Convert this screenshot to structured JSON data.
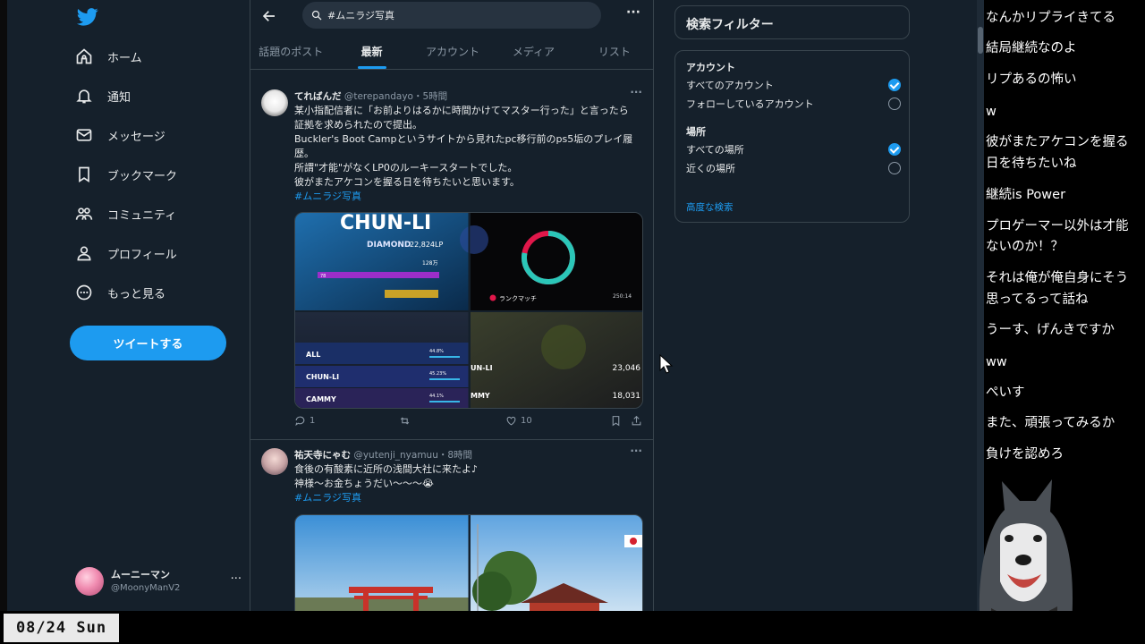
{
  "sidebar": {
    "logo": "twitter-bird-icon",
    "items": [
      {
        "label": "ホーム",
        "icon": "home-icon"
      },
      {
        "label": "通知",
        "icon": "bell-icon"
      },
      {
        "label": "メッセージ",
        "icon": "mail-icon"
      },
      {
        "label": "ブックマーク",
        "icon": "bookmark-icon"
      },
      {
        "label": "コミュニティ",
        "icon": "people-icon"
      },
      {
        "label": "プロフィール",
        "icon": "person-icon"
      },
      {
        "label": "もっと見る",
        "icon": "more-circle-icon"
      }
    ],
    "tweet_button": "ツイートする",
    "account": {
      "name": "ムーニーマン",
      "handle": "@MoonyManV2",
      "more": "···"
    }
  },
  "search": {
    "query": "#ムニラジ写真",
    "more": "···"
  },
  "tabs": [
    {
      "label": "話題のポスト",
      "active": false
    },
    {
      "label": "最新",
      "active": true
    },
    {
      "label": "アカウント",
      "active": false
    },
    {
      "label": "メディア",
      "active": false
    },
    {
      "label": "リスト",
      "active": false
    }
  ],
  "tweets": [
    {
      "name": "てればんだ",
      "handle": "@terepandayo",
      "time": "・5時間",
      "lines": [
        "某小指配信者に「お前よりはるかに時間かけてマスター行った」と言ったら",
        "証拠を求められたので提出。",
        "Buckler's Boot Campというサイトから見れたpc移行前のps5垢のプレイ履",
        "歴。",
        "所謂\"才能\"がなくLP0のルーキースタートでした。",
        "彼がまたアケコンを握る日を待ちたいと思います。"
      ],
      "hashtag": "#ムニラジ写真",
      "media": {
        "img1": {
          "title": "CHUN-LI",
          "rank": "DIAMOND",
          "lp": "22,824LP",
          "bar_label": "78",
          "stat": "128万"
        },
        "img2": {
          "label": "ランクマッチ",
          "time": "250:14",
          "ring_fill": 0.78
        },
        "img3": {
          "rows": [
            {
              "name": "ALL",
              "pct": "44.8%"
            },
            {
              "name": "CHUN-LI",
              "pct": "45.23%"
            },
            {
              "name": "CAMMY",
              "pct": "44.1%"
            }
          ]
        },
        "img4": {
          "rows": [
            {
              "name": "UN-LI",
              "value": "23,046"
            },
            {
              "name": "MMY",
              "value": "18,031"
            }
          ]
        }
      },
      "replies": "1",
      "retweets": "",
      "likes": "10"
    },
    {
      "name": "祐天寺にゃむ",
      "handle": "@yutenji_nyamuu",
      "time": "・8時間",
      "lines": [
        "食後の有酸素に近所の浅間大社に来たよ♪",
        "神様〜お金ちょうだい〜〜〜😭"
      ],
      "hashtag": "#ムニラジ写真"
    }
  ],
  "filters": {
    "title": "検索フィルター",
    "account_section": "アカウント",
    "account_options": [
      {
        "label": "すべてのアカウント",
        "selected": true
      },
      {
        "label": "フォローしているアカウント",
        "selected": false
      }
    ],
    "location_section": "場所",
    "location_options": [
      {
        "label": "すべての場所",
        "selected": true
      },
      {
        "label": "近くの場所",
        "selected": false
      }
    ],
    "advanced": "高度な検索"
  },
  "chat": [
    "なんかリプライきてる",
    "結局継続なのよ",
    "リプあるの怖い",
    "w",
    "彼がまたアケコンを握る",
    "日を待ちたいね",
    "継続is Power",
    "プロゲーマー以外は才能",
    "ないのか！？",
    "それは俺が俺自身にそう",
    "思ってるって話ね",
    "うーす、げんきですか",
    "ww",
    "ぺいす",
    "また、頑張ってみるか",
    "負けを認めろ"
  ],
  "date": "08/24 Sun",
  "colors": {
    "accent": "#1d9bf0",
    "background": "#15202b",
    "border": "#38444d",
    "muted": "#8b98a5"
  }
}
